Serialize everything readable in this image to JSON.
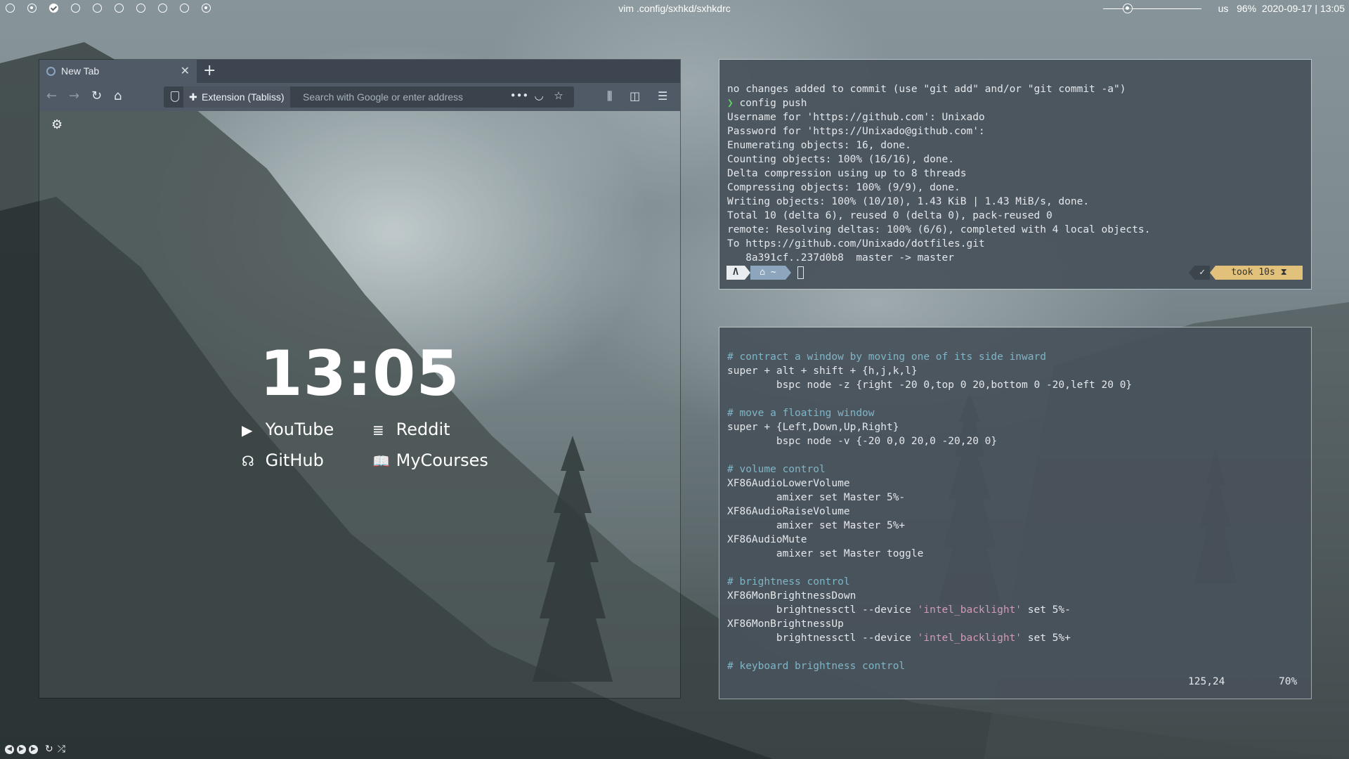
{
  "topbar": {
    "workspaces": [
      {
        "state": "empty"
      },
      {
        "state": "dot"
      },
      {
        "state": "check"
      },
      {
        "state": "empty"
      },
      {
        "state": "empty"
      },
      {
        "state": "empty"
      },
      {
        "state": "empty"
      },
      {
        "state": "empty"
      },
      {
        "state": "empty"
      },
      {
        "state": "dot"
      }
    ],
    "window_title": "vim .config/sxhkd/sxhkdrc",
    "keyboard_layout": "us",
    "battery": "96%",
    "datetime": "2020-09-17 | 13:05",
    "volume_level_percent": 25
  },
  "browser": {
    "tab_title": "New Tab",
    "tab_close_icon": "close-icon",
    "new_tab_icon": "plus-icon",
    "extension_label": "Extension (Tabliss)",
    "url_placeholder": "Search with Google or enter address",
    "content": {
      "clock": "13:05",
      "links": [
        {
          "label": "YouTube",
          "icon": "youtube-icon"
        },
        {
          "label": "Reddit",
          "icon": "list-icon"
        },
        {
          "label": "GitHub",
          "icon": "github-icon"
        },
        {
          "label": "MyCourses",
          "icon": "book-icon"
        }
      ]
    }
  },
  "terminal_git": {
    "lines": [
      "no changes added to commit (use \"git add\" and/or \"git commit -a\")",
      "config push",
      "Username for 'https://github.com': Unixado",
      "Password for 'https://Unixado@github.com':",
      "Enumerating objects: 16, done.",
      "Counting objects: 100% (16/16), done.",
      "Delta compression using up to 8 threads",
      "Compressing objects: 100% (9/9), done.",
      "Writing objects: 100% (10/10), 1.43 KiB | 1.43 MiB/s, done.",
      "Total 10 (delta 6), reused 0 (delta 0), pack-reused 0",
      "remote: Resolving deltas: 100% (6/6), completed with 4 local objects.",
      "To https://github.com/Unixado/dotfiles.git",
      "   8a391cf..237d0b8  master -> master"
    ],
    "prompt_arrow": "❯",
    "prompt_os": "Λ",
    "prompt_dir": "⌂ ~",
    "right_check": "✓",
    "right_took": "took 10s ⧗"
  },
  "terminal_vim": {
    "lines": [
      {
        "type": "comment",
        "text": "# contract a window by moving one of its side inward"
      },
      {
        "type": "plain",
        "text": "super + alt + shift + {h,j,k,l}"
      },
      {
        "type": "plain",
        "text": "        bspc node -z {right -20 0,top 0 20,bottom 0 -20,left 20 0}"
      },
      {
        "type": "blank",
        "text": ""
      },
      {
        "type": "comment",
        "text": "# move a floating window"
      },
      {
        "type": "plain",
        "text": "super + {Left,Down,Up,Right}"
      },
      {
        "type": "plain",
        "text": "        bspc node -v {-20 0,0 20,0 -20,20 0}"
      },
      {
        "type": "blank",
        "text": ""
      },
      {
        "type": "comment",
        "text": "# volume control"
      },
      {
        "type": "plain",
        "text": "XF86AudioLowerVolume"
      },
      {
        "type": "plain",
        "text": "        amixer set Master 5%-"
      },
      {
        "type": "plain",
        "text": "XF86AudioRaiseVolume"
      },
      {
        "type": "plain",
        "text": "        amixer set Master 5%+"
      },
      {
        "type": "plain",
        "text": "XF86AudioMute"
      },
      {
        "type": "plain",
        "text": "        amixer set Master toggle"
      },
      {
        "type": "blank",
        "text": ""
      },
      {
        "type": "comment",
        "text": "# brightness control"
      },
      {
        "type": "plain",
        "text": "XF86MonBrightnessDown"
      },
      {
        "type": "mixed",
        "pre": "        brightnessctl --device ",
        "str": "'intel_backlight'",
        "post": " set 5%-"
      },
      {
        "type": "plain",
        "text": "XF86MonBrightnessUp"
      },
      {
        "type": "mixed",
        "pre": "        brightnessctl --device ",
        "str": "'intel_backlight'",
        "post": " set 5%+"
      },
      {
        "type": "blank",
        "text": ""
      },
      {
        "type": "comment",
        "text": "# keyboard brightness control"
      }
    ],
    "cursor_pos": "125,24",
    "scroll_percent": "70%"
  },
  "colors": {
    "comment": "#7fb5c7",
    "string": "#d29bb4",
    "prompt_green": "#5fd35f",
    "took_badge": "#e2c17a"
  }
}
